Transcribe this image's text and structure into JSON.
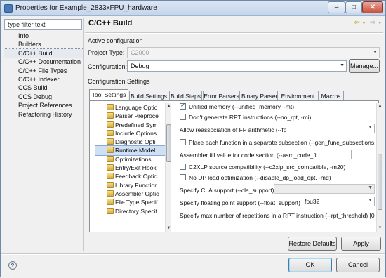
{
  "window": {
    "title": "Properties for Example_2833xFPU_hardware",
    "controls": {
      "minimize": "–",
      "maximize": "□",
      "close": "✕"
    }
  },
  "filter": {
    "value": "type filter text"
  },
  "nav": {
    "items": [
      {
        "label": "Info"
      },
      {
        "label": "Builders"
      },
      {
        "label": "C/C++ Build"
      },
      {
        "label": "C/C++ Documentation"
      },
      {
        "label": "C/C++ File Types"
      },
      {
        "label": "C/C++ Indexer"
      },
      {
        "label": "CCS Build"
      },
      {
        "label": "CCS Debug"
      },
      {
        "label": "Project References"
      },
      {
        "label": "Refactoring History"
      }
    ]
  },
  "page": {
    "title": "C/C++ Build",
    "back_icon": "arrow-left-icon",
    "forward_icon": "arrow-right-icon"
  },
  "active_config": {
    "heading": "Active configuration",
    "project_type_label": "Project Type:",
    "project_type_value": "C2000",
    "configuration_label": "Configuration:",
    "configuration_value": "Debug",
    "manage_label": "Manage..."
  },
  "config_settings": {
    "heading": "Configuration Settings",
    "tabs": [
      {
        "label": "Tool Settings"
      },
      {
        "label": "Build Settings"
      },
      {
        "label": "Build Steps"
      },
      {
        "label": "Error Parsers"
      },
      {
        "label": "Binary Parser"
      },
      {
        "label": "Environment"
      },
      {
        "label": "Macros"
      }
    ],
    "tree": [
      {
        "label": "Language Optic"
      },
      {
        "label": "Parser Preproce"
      },
      {
        "label": "Predefined Sym"
      },
      {
        "label": "Include Options"
      },
      {
        "label": "Diagnostic Opti"
      },
      {
        "label": "Runtime Model"
      },
      {
        "label": "Optimizations"
      },
      {
        "label": "Entry/Exit Hook"
      },
      {
        "label": "Feedback Optic"
      },
      {
        "label": "Library Functior"
      },
      {
        "label": "Assembler Optic"
      },
      {
        "label": "File Type Specif"
      },
      {
        "label": "Directory Specif"
      }
    ],
    "options": {
      "unified_memory": "Unified memory (--unified_memory, -mt)",
      "no_rpt": "Don't generate RPT instructions (--no_rpt, -mi)",
      "fp_reassoc": "Allow reassociation of FP arithmetic (--fp_reassoc)",
      "gen_func_subsections": "Place each function in a separate subsection (--gen_func_subsections, -",
      "asm_code_fill": "Assembler fill value for code section (--asm_code_fill)",
      "c2xlp_src_compatible": "C2XLP source compatibility (--c2xlp_src_compatible, -m20)",
      "disable_dp_load_opt": "No DP load optimization (--disable_dp_load_opt, -md)",
      "cla_support": "Specify CLA support (--cla_support)",
      "float_support": "Specify floating point support (--float_support)",
      "float_support_value": "fpu32",
      "rpt_threshold": "Specify max number of repetitions in a RPT instruction (--rpt_threshold) [0"
    }
  },
  "buttons": {
    "restore_defaults": "Restore Defaults",
    "apply": "Apply",
    "ok": "OK",
    "cancel": "Cancel",
    "help": "?"
  }
}
